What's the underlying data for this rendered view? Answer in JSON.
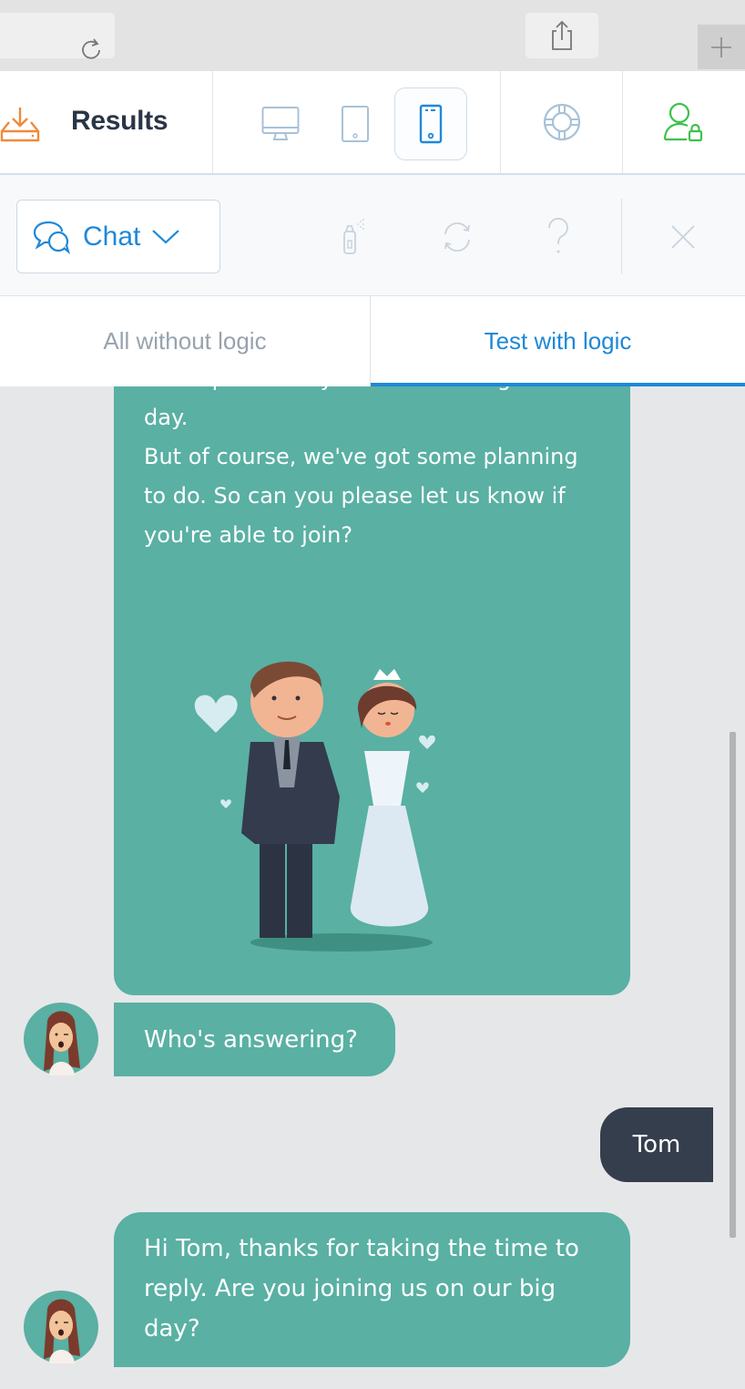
{
  "browser": {
    "icons": [
      "reload-icon",
      "share-icon",
      "tabs-icon",
      "plus-icon"
    ]
  },
  "header": {
    "title": "Results",
    "title_icon": "download-tray-icon",
    "devices": [
      {
        "name": "desktop",
        "icon": "desktop-icon",
        "active": false
      },
      {
        "name": "tablet",
        "icon": "tablet-icon",
        "active": false
      },
      {
        "name": "mobile",
        "icon": "mobile-icon",
        "active": true
      }
    ],
    "help_icon": "lifebuoy-icon",
    "user_icon": "user-lock-icon"
  },
  "toolbar": {
    "mode_label": "Chat",
    "mode_icon": "chat-bubbles-icon",
    "actions": [
      "spray-icon",
      "refresh-icon",
      "help-icon",
      "close-icon"
    ]
  },
  "tabs": [
    {
      "label": "All without logic",
      "active": false
    },
    {
      "label": "Test with logic",
      "active": true
    }
  ],
  "conversation": {
    "bot_message_1_lines": [
      "We hope to see you all on our big",
      "day.",
      "But of course, we've got some planning",
      "to do. So can you please let us know if",
      "you're able to join?"
    ],
    "bot_message_1_image": "wedding-couple-illustration",
    "bot_message_2": "Who's answering?",
    "user_message_1": "Tom",
    "bot_message_3": "Hi Tom, thanks for taking the time to reply. Are you joining us on our big day?"
  },
  "colors": {
    "accent": "#1e88d8",
    "bot_bubble": "#59b0a3",
    "user_bubble": "#353e4c",
    "results_icon": "#f08a3c",
    "user_icon": "#3cc24b",
    "background": "#e6e7e9"
  }
}
